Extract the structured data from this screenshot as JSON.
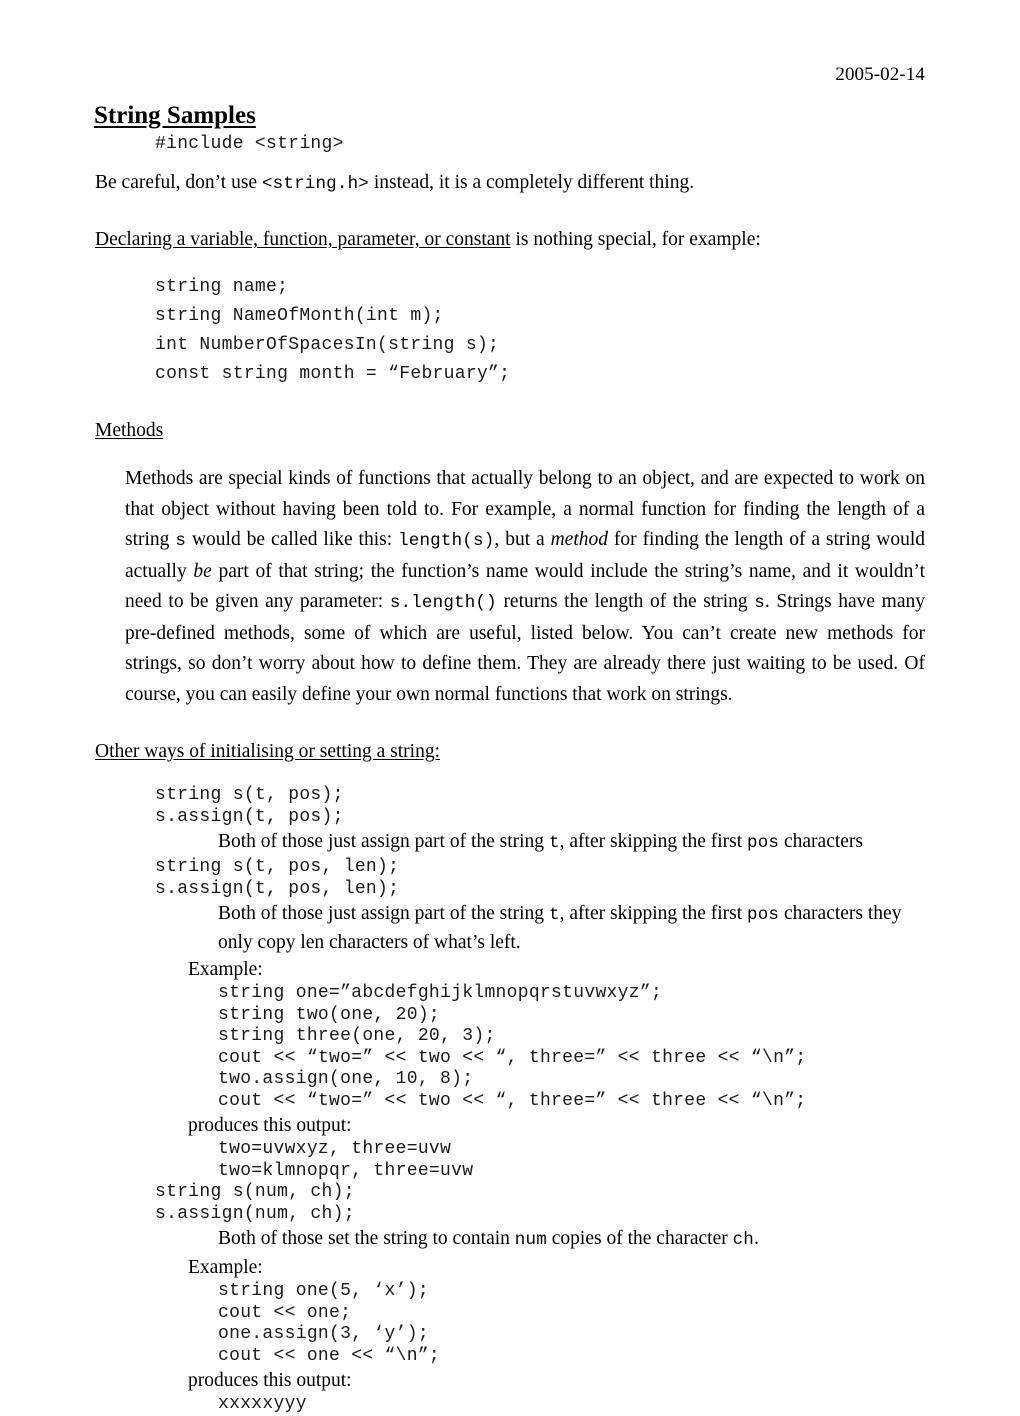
{
  "document": {
    "date": "2005-02-14",
    "title": "String Samples"
  },
  "intro": {
    "include_line": "#include <string>",
    "warning_prefix": "Be careful, don’t use ",
    "warning_code": "<string.h>",
    "warning_suffix": " instead, it is a completely different thing."
  },
  "declaring": {
    "heading_underlined": "Declaring a variable, function, parameter, or constant",
    "heading_rest": " is nothing special, for example:",
    "code": "string name;\nstring NameOfMonth(int m);\nint NumberOfSpacesIn(string s);\nconst string month = “February”;"
  },
  "methods": {
    "heading": "Methods",
    "p1_a": "Methods are special kinds of functions that actually belong to an object, and are expected to work on that object without having been told to. For example, a normal function for finding the length of a string ",
    "p1_code1": "s",
    "p1_b": " would be called like this: ",
    "p1_code2": "length(s)",
    "p1_c": ", but a ",
    "p1_em1": "method",
    "p1_d": " for finding the length of a string would actually ",
    "p1_em2": "be",
    "p1_e": " part of that string; the function’s name would include the string’s name, and it wouldn’t need to be given any parameter: ",
    "p1_code3": "s.length()",
    "p1_f": " returns the length of the string ",
    "p1_code4": "s",
    "p1_g": ".  Strings have many pre-defined methods, some of which are useful, listed below. You can’t create new methods for strings, so don’t worry about how to define them. They are already there just waiting to be used. Of course, you can easily define your own normal functions that work on strings."
  },
  "other_ways": {
    "heading": "Other ways of initialising or setting a string:",
    "block1": {
      "code": "string s(t, pos);\ns.assign(t, pos);",
      "desc_a": "Both of those just assign part of the string ",
      "desc_code1": "t",
      "desc_b": ", after skipping the first ",
      "desc_code2": "pos",
      "desc_c": " characters"
    },
    "block2": {
      "code": "string s(t, pos, len);\ns.assign(t, pos, len);",
      "desc_a": "Both of those just assign part of the string ",
      "desc_code1": "t",
      "desc_b": ", after skipping the first ",
      "desc_code2": "pos",
      "desc_c": " characters they only copy len characters of what’s left.",
      "example_label": "Example:",
      "example_code": "string one=”abcdefghijklmnopqrstuvwxyz”;\nstring two(one, 20);\nstring three(one, 20, 3);\ncout << “two=” << two << “, three=” << three << “\\n”;\ntwo.assign(one, 10, 8);\ncout << “two=” << two << “, three=” << three << “\\n”;",
      "output_label": "produces this output:",
      "output_code": "two=uvwxyz, three=uvw\ntwo=klmnopqr, three=uvw"
    },
    "block3": {
      "code": "string s(num, ch);\ns.assign(num, ch);",
      "desc_a": "Both of those set the string to contain ",
      "desc_code1": "num",
      "desc_b": " copies of the character ",
      "desc_code2": "ch",
      "desc_c": ".",
      "example_label": "Example:",
      "example_code": "string one(5, ‘x’);\ncout << one;\none.assign(3, ‘y’);\ncout << one << “\\n”;",
      "output_label": "produces this output:",
      "output_code": "xxxxxyyy"
    }
  }
}
